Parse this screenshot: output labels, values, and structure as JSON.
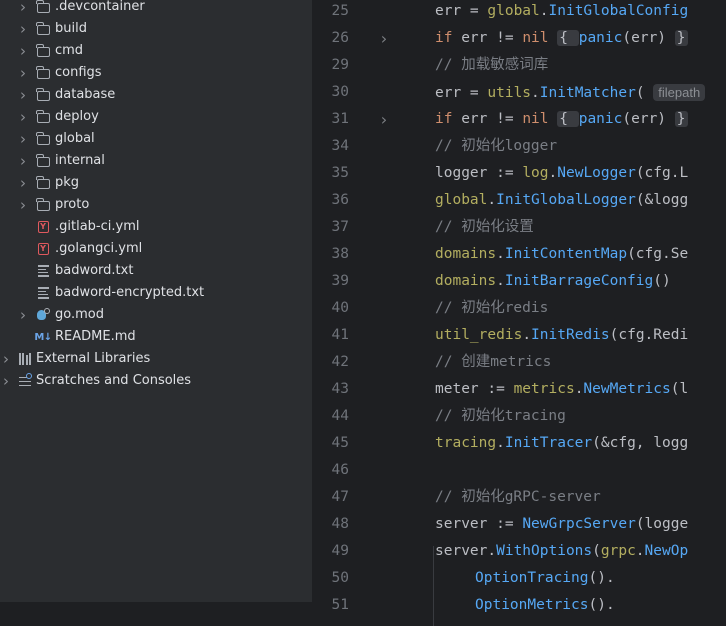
{
  "project_tree": {
    "items": [
      {
        "label": ".devcontainer",
        "kind": "folder",
        "icon": "folder-icon",
        "expandable": true
      },
      {
        "label": "build",
        "kind": "folder",
        "icon": "folder-icon",
        "expandable": true
      },
      {
        "label": "cmd",
        "kind": "folder",
        "icon": "folder-icon",
        "expandable": true
      },
      {
        "label": "configs",
        "kind": "folder",
        "icon": "folder-icon",
        "expandable": true
      },
      {
        "label": "database",
        "kind": "folder",
        "icon": "folder-icon",
        "expandable": true
      },
      {
        "label": "deploy",
        "kind": "folder",
        "icon": "folder-icon",
        "expandable": true
      },
      {
        "label": "global",
        "kind": "folder",
        "icon": "folder-icon",
        "expandable": true
      },
      {
        "label": "internal",
        "kind": "folder",
        "icon": "folder-icon",
        "expandable": true
      },
      {
        "label": "pkg",
        "kind": "folder",
        "icon": "folder-icon",
        "expandable": true
      },
      {
        "label": "proto",
        "kind": "folder",
        "icon": "folder-icon",
        "expandable": true
      },
      {
        "label": ".gitlab-ci.yml",
        "kind": "yml",
        "icon": "yaml-file-icon",
        "expandable": false
      },
      {
        "label": ".golangci.yml",
        "kind": "yml",
        "icon": "yaml-file-icon",
        "expandable": false
      },
      {
        "label": "badword.txt",
        "kind": "txt",
        "icon": "text-file-icon",
        "expandable": false
      },
      {
        "label": "badword-encrypted.txt",
        "kind": "txt",
        "icon": "text-file-icon",
        "expandable": false
      },
      {
        "label": "go.mod",
        "kind": "gomod",
        "icon": "go-module-icon",
        "expandable": true
      },
      {
        "label": "README.md",
        "kind": "md",
        "icon": "markdown-file-icon",
        "expandable": false
      }
    ],
    "roots": [
      {
        "label": "External Libraries",
        "kind": "lib",
        "icon": "library-icon"
      },
      {
        "label": "Scratches and Consoles",
        "kind": "scratch",
        "icon": "scratches-icon"
      }
    ],
    "md_badge_text": "M↓",
    "yml_badge_text": "Y"
  },
  "editor": {
    "lines": [
      {
        "num": "25",
        "tokens": [
          [
            "fd",
            "err = "
          ],
          [
            "pkg",
            "global"
          ],
          [
            "fd",
            "."
          ],
          [
            "fn",
            "InitGlobalConfig"
          ]
        ]
      },
      {
        "num": "26",
        "fold": true,
        "tokens": [
          [
            "kw",
            "if "
          ],
          [
            "fd",
            "err != "
          ],
          [
            "kw",
            "nil"
          ],
          [
            "fd",
            " "
          ],
          [
            "box",
            "{ "
          ],
          [
            "fn",
            "panic"
          ],
          [
            "fd",
            "(err) "
          ],
          [
            "box",
            "}"
          ]
        ]
      },
      {
        "num": "29",
        "tokens": [
          [
            "cm",
            "// 加载敏感词库"
          ]
        ]
      },
      {
        "num": "30",
        "tokens": [
          [
            "fd",
            "err = "
          ],
          [
            "pkg",
            "utils"
          ],
          [
            "fd",
            "."
          ],
          [
            "fn",
            "InitMatcher"
          ],
          [
            "fd",
            "( "
          ],
          [
            "inlay",
            "filepath"
          ]
        ]
      },
      {
        "num": "31",
        "fold": true,
        "tokens": [
          [
            "kw",
            "if "
          ],
          [
            "fd",
            "err != "
          ],
          [
            "kw",
            "nil"
          ],
          [
            "fd",
            " "
          ],
          [
            "box",
            "{ "
          ],
          [
            "fn",
            "panic"
          ],
          [
            "fd",
            "(err) "
          ],
          [
            "box",
            "}"
          ]
        ]
      },
      {
        "num": "34",
        "tokens": [
          [
            "cm",
            "// 初始化logger"
          ]
        ]
      },
      {
        "num": "35",
        "tokens": [
          [
            "fd",
            "logger := "
          ],
          [
            "pkg",
            "log"
          ],
          [
            "fd",
            "."
          ],
          [
            "fn",
            "NewLogger"
          ],
          [
            "fd",
            "(cfg.L"
          ]
        ]
      },
      {
        "num": "36",
        "tokens": [
          [
            "pkg",
            "global"
          ],
          [
            "fd",
            "."
          ],
          [
            "fn",
            "InitGlobalLogger"
          ],
          [
            "fd",
            "(&logg"
          ]
        ]
      },
      {
        "num": "37",
        "tokens": [
          [
            "cm",
            "// 初始化设置"
          ]
        ]
      },
      {
        "num": "38",
        "tokens": [
          [
            "pkg",
            "domains"
          ],
          [
            "fd",
            "."
          ],
          [
            "fn",
            "InitContentMap"
          ],
          [
            "fd",
            "(cfg.Se"
          ]
        ]
      },
      {
        "num": "39",
        "tokens": [
          [
            "pkg",
            "domains"
          ],
          [
            "fd",
            "."
          ],
          [
            "fn",
            "InitBarrageConfig"
          ],
          [
            "fd",
            "()"
          ]
        ]
      },
      {
        "num": "40",
        "tokens": [
          [
            "cm",
            "// 初始化redis"
          ]
        ]
      },
      {
        "num": "41",
        "tokens": [
          [
            "pkg",
            "util_redis"
          ],
          [
            "fd",
            "."
          ],
          [
            "fn",
            "InitRedis"
          ],
          [
            "fd",
            "(cfg.Redi"
          ]
        ]
      },
      {
        "num": "42",
        "tokens": [
          [
            "cm",
            "// 创建metrics"
          ]
        ]
      },
      {
        "num": "43",
        "tokens": [
          [
            "fd",
            "meter := "
          ],
          [
            "pkg",
            "metrics"
          ],
          [
            "fd",
            "."
          ],
          [
            "fn",
            "NewMetrics"
          ],
          [
            "fd",
            "(l"
          ]
        ]
      },
      {
        "num": "44",
        "tokens": [
          [
            "cm",
            "// 初始化tracing"
          ]
        ]
      },
      {
        "num": "45",
        "tokens": [
          [
            "pkg",
            "tracing"
          ],
          [
            "fd",
            "."
          ],
          [
            "fn",
            "InitTracer"
          ],
          [
            "fd",
            "(&cfg, logg"
          ]
        ]
      },
      {
        "num": "46",
        "tokens": []
      },
      {
        "num": "47",
        "tokens": [
          [
            "cm",
            "// 初始化gRPC-server"
          ]
        ]
      },
      {
        "num": "48",
        "tokens": [
          [
            "fd",
            "server := "
          ],
          [
            "fn",
            "NewGrpcServer"
          ],
          [
            "fd",
            "(logge"
          ]
        ]
      },
      {
        "num": "49",
        "tokens": [
          [
            "fd",
            "server."
          ],
          [
            "fn",
            "WithOptions"
          ],
          [
            "fd",
            "("
          ],
          [
            "pkg",
            "grpc"
          ],
          [
            "fd",
            "."
          ],
          [
            "fn",
            "NewOp"
          ]
        ]
      },
      {
        "num": "50",
        "indent": true,
        "tokens": [
          [
            "fn",
            "OptionTracing"
          ],
          [
            "fd",
            "()."
          ]
        ]
      },
      {
        "num": "51",
        "indent": true,
        "tokens": [
          [
            "fn",
            "OptionMetrics"
          ],
          [
            "fd",
            "()."
          ]
        ]
      }
    ]
  }
}
